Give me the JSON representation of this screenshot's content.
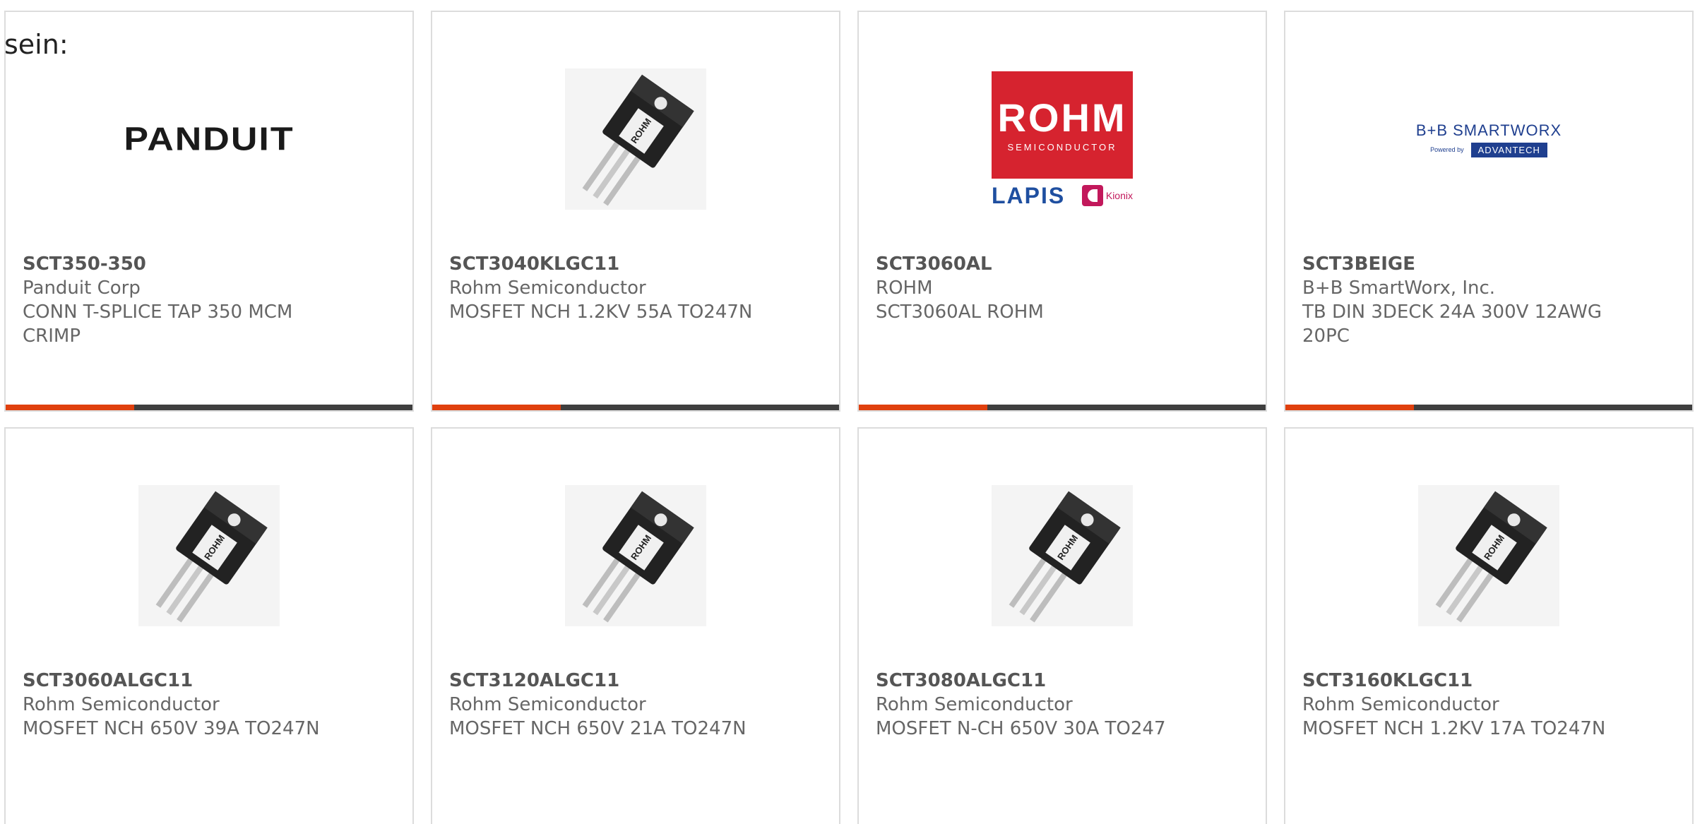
{
  "intro_text": "sein:",
  "colors": {
    "accent": "#e0400e",
    "bar_dark": "#3f3f3f",
    "rohm_red": "#d6232f"
  },
  "products": [
    {
      "part_number": "SCT350-350",
      "manufacturer": "Panduit Corp",
      "description_line1": "CONN T-SPLICE TAP 350 MCM",
      "description_line2": "CRIMP",
      "image": "panduit-logo",
      "logo_text": "PANDUIT"
    },
    {
      "part_number": "SCT3040KLGC11",
      "manufacturer": "Rohm Semiconductor",
      "description_line1": "MOSFET NCH 1.2KV 55A TO247N",
      "description_line2": "",
      "image": "to247-transistor"
    },
    {
      "part_number": "SCT3060AL",
      "manufacturer": "ROHM",
      "description_line1": "SCT3060AL ROHM",
      "description_line2": "",
      "image": "rohm-logo",
      "logo_text": "ROHM",
      "logo_sub": "SEMICONDUCTOR",
      "logo_lapis": "LAPIS",
      "logo_kionix": "Kionix"
    },
    {
      "part_number": "SCT3BEIGE",
      "manufacturer": "B+B SmartWorx, Inc.",
      "description_line1": "TB DIN 3DECK 24A 300V 12AWG",
      "description_line2": "20PC",
      "image": "bb-smartworx-logo",
      "logo_line1": "B+B SMARTWORX",
      "logo_powered": "Powered by",
      "logo_adv": "ADVANTECH"
    },
    {
      "part_number": "SCT3060ALGC11",
      "manufacturer": "Rohm Semiconductor",
      "description_line1": "MOSFET NCH 650V 39A TO247N",
      "description_line2": "",
      "image": "to247-transistor"
    },
    {
      "part_number": "SCT3120ALGC11",
      "manufacturer": "Rohm Semiconductor",
      "description_line1": "MOSFET NCH 650V 21A TO247N",
      "description_line2": "",
      "image": "to247-transistor"
    },
    {
      "part_number": "SCT3080ALGC11",
      "manufacturer": "Rohm Semiconductor",
      "description_line1": "MOSFET N-CH 650V 30A TO247",
      "description_line2": "",
      "image": "to247-transistor"
    },
    {
      "part_number": "SCT3160KLGC11",
      "manufacturer": "Rohm Semiconductor",
      "description_line1": "MOSFET NCH 1.2KV 17A TO247N",
      "description_line2": "",
      "image": "to247-transistor"
    }
  ]
}
